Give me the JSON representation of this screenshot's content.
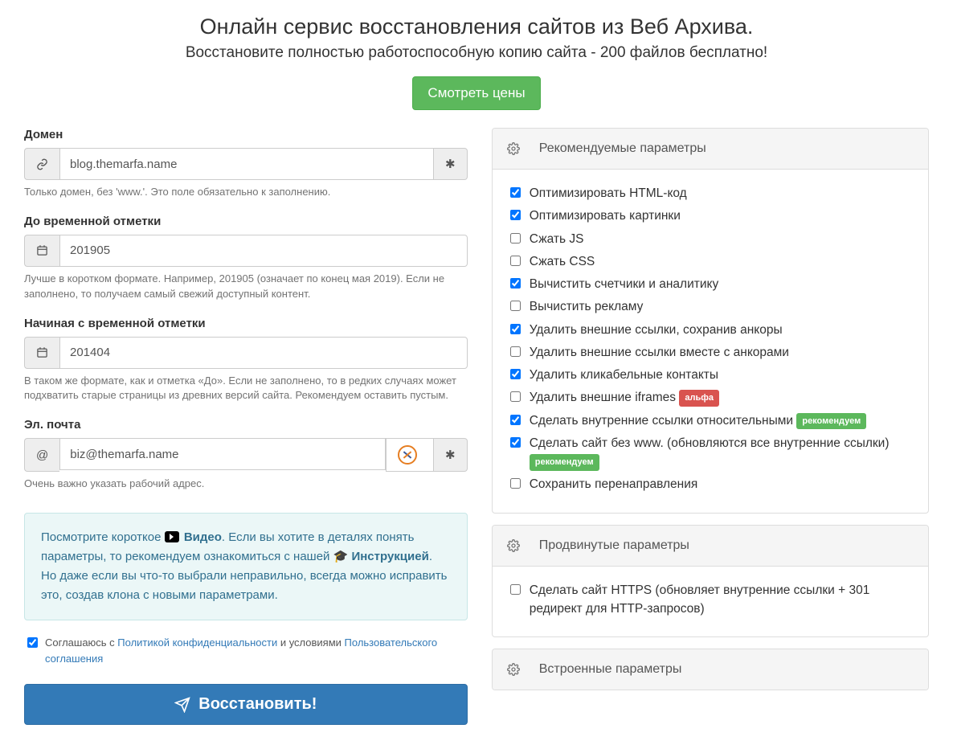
{
  "header": {
    "title": "Онлайн сервис восстановления сайтов из Веб Архива.",
    "subtitle": "Восстановите полностью работоспособную копию сайта - 200 файлов бесплатно!",
    "cta": "Смотреть цены"
  },
  "domain": {
    "label": "Домен",
    "value": "blog.themarfa.name",
    "required_mark": "✱",
    "help": "Только домен, без 'www.'. Это поле обязательно к заполнению."
  },
  "to_ts": {
    "label": "До временной отметки",
    "value": "201905",
    "help": "Лучше в коротком формате. Например, 201905 (означает по конец мая 2019). Если не заполнено, то получаем самый свежий доступный контент."
  },
  "from_ts": {
    "label": "Начиная с временной отметки",
    "value": "201404",
    "help": "В таком же формате, как и отметка «До». Если не заполнено, то в редких случаях может подхватить старые страницы из древних версий сайта. Рекомендуем оставить пустым."
  },
  "email": {
    "label": "Эл. почта",
    "value": "biz@themarfa.name",
    "required_mark": "✱",
    "help": "Очень важно указать рабочий адрес."
  },
  "info_box": {
    "t1": "Посмотрите короткое ",
    "video": "Видео",
    "t2": ". Если вы хотите в деталях понять параметры, то рекомендуем ознакомиться с нашей ",
    "instr": "Инструкцией",
    "t3": ". Но даже если вы что-то выбрали неправильно, всегда можно исправить это, создав клона с новыми параметрами."
  },
  "tos": {
    "t1": "Соглашаюсь с ",
    "link1": "Политикой конфиденциальности",
    "t2": " и условиями ",
    "link2": "Пользовательского соглашения"
  },
  "submit_label": "Восстановить!",
  "panels": {
    "recommended": "Рекомендуемые параметры",
    "advanced": "Продвинутые параметры",
    "builtin": "Встроенные параметры"
  },
  "recommended_opts": [
    {
      "label": "Оптимизировать HTML-код",
      "checked": true
    },
    {
      "label": "Оптимизировать картинки",
      "checked": true
    },
    {
      "label": "Сжать JS",
      "checked": false
    },
    {
      "label": "Сжать CSS",
      "checked": false
    },
    {
      "label": "Вычистить счетчики и аналитику",
      "checked": true
    },
    {
      "label": "Вычистить рекламу",
      "checked": false
    },
    {
      "label": "Удалить внешние ссылки, сохранив анкоры",
      "checked": true
    },
    {
      "label": "Удалить внешние ссылки вместе с анкорами",
      "checked": false
    },
    {
      "label": "Удалить кликабельные контакты",
      "checked": true
    },
    {
      "label": "Удалить внешние iframes",
      "checked": false,
      "badge": "альфа",
      "badge_class": "badge-alpha"
    },
    {
      "label": "Сделать внутренние ссылки относительными",
      "checked": true,
      "badge": "рекомендуем",
      "badge_class": "badge-rec"
    },
    {
      "label": "Сделать сайт без www. (обновляются все внутренние ссылки)",
      "checked": true,
      "badge": "рекомендуем",
      "badge_class": "badge-rec"
    },
    {
      "label": "Сохранить перенаправления",
      "checked": false
    }
  ],
  "advanced_opts": [
    {
      "label": "Сделать сайт HTTPS (обновляет внутренние ссылки + 301 редирект для HTTP-запросов)",
      "checked": false
    }
  ]
}
